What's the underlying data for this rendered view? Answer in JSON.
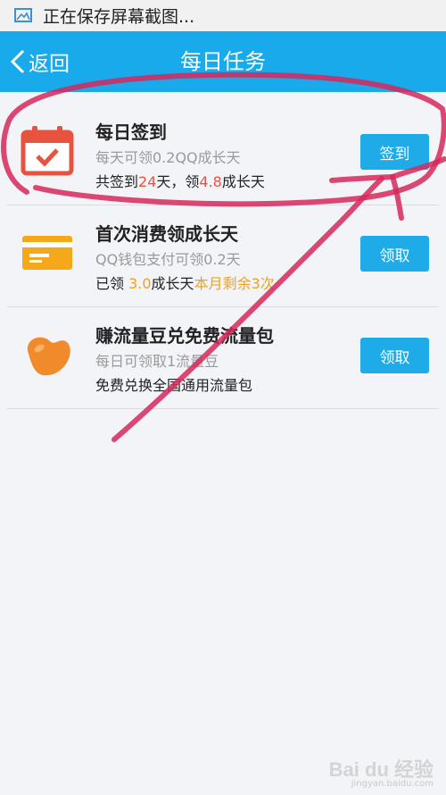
{
  "status_bar": {
    "text": "正在保存屏幕截图...",
    "icon": "screenshot-icon"
  },
  "header": {
    "back_label": "返回",
    "title": "每日任务"
  },
  "colors": {
    "header_bg": "#18aaea",
    "button_bg": "#1eabe8",
    "highlight_red": "#e8533f",
    "highlight_orange": "#f0a21d",
    "annotation_red": "#d6285c"
  },
  "tasks": [
    {
      "icon": "calendar-check-icon",
      "title": "每日签到",
      "subtitle": "每天可领0.2QQ成长天",
      "detail": {
        "p1": "共签到",
        "v1": "24",
        "p2": "天，领",
        "v2": "4.8",
        "p3": "成长天"
      },
      "button": "签到"
    },
    {
      "icon": "card-icon",
      "title": "首次消费领成长天",
      "subtitle": "QQ钱包支付可领0.2天",
      "detail": {
        "p1": "已领 ",
        "v1": "3.0",
        "p2": "成长天",
        "v2": "本月剩余3次"
      },
      "button": "领取"
    },
    {
      "icon": "bean-icon",
      "title": "赚流量豆兑免费流量包",
      "subtitle": "每日可领取1流量豆",
      "detail": {
        "p1": "免费兑换全国通用流量包"
      },
      "button": "领取"
    }
  ],
  "watermark": {
    "brand": "Bai du 经验",
    "url": "jingyan.baidu.com"
  }
}
